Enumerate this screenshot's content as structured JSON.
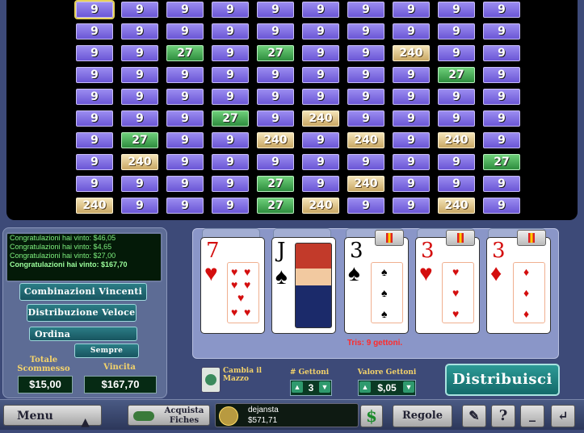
{
  "grid": [
    [
      "9",
      "9",
      "9",
      "9",
      "9",
      "9",
      "9",
      "9",
      "9",
      "9"
    ],
    [
      "9",
      "9",
      "9",
      "9",
      "9",
      "9",
      "9",
      "9",
      "9",
      "9"
    ],
    [
      "9",
      "9",
      "27",
      "9",
      "27",
      "9",
      "9",
      "240",
      "9",
      "9"
    ],
    [
      "9",
      "9",
      "9",
      "9",
      "9",
      "9",
      "9",
      "9",
      "27",
      "9"
    ],
    [
      "9",
      "9",
      "9",
      "9",
      "9",
      "9",
      "9",
      "9",
      "9",
      "9"
    ],
    [
      "9",
      "9",
      "9",
      "27",
      "9",
      "240",
      "9",
      "9",
      "9",
      "9"
    ],
    [
      "9",
      "27",
      "9",
      "9",
      "240",
      "9",
      "240",
      "9",
      "240",
      "9"
    ],
    [
      "9",
      "240",
      "9",
      "9",
      "9",
      "9",
      "9",
      "9",
      "9",
      "27"
    ],
    [
      "9",
      "9",
      "9",
      "9",
      "27",
      "9",
      "240",
      "9",
      "9",
      "9"
    ],
    [
      "240",
      "9",
      "9",
      "9",
      "27",
      "240",
      "9",
      "9",
      "240",
      "9"
    ]
  ],
  "messages": [
    "Congratulazioni hai vinto: $46,05",
    "Congratulazioni hai vinto: $4,65",
    "Congratulazioni hai vinto: $27,00",
    "Congratulazioni hai vinto: $167,70"
  ],
  "buttons": {
    "combinazioni": "Combinazioni Vincenti",
    "distribuzione": "Distribuzione Veloce",
    "ordina": "Ordina",
    "sempre": "Sempre",
    "deal": "Distribuisci",
    "menu": "Menu",
    "acquista": "Acquista Fiches",
    "regole": "Regole"
  },
  "totals": {
    "bet_label": "Totale Scommesso",
    "bet_value": "$15,00",
    "win_label": "Vincita",
    "win_value": "$167,70"
  },
  "cards": [
    {
      "rank": "7",
      "suit": "♥",
      "color": "red",
      "held": false
    },
    {
      "rank": "J",
      "suit": "♠",
      "color": "black",
      "held": false
    },
    {
      "rank": "3",
      "suit": "♠",
      "color": "black",
      "held": true
    },
    {
      "rank": "3",
      "suit": "♥",
      "color": "red",
      "held": true
    },
    {
      "rank": "3",
      "suit": "♦",
      "color": "red",
      "held": true
    }
  ],
  "result": "Tris: 9 gettoni.",
  "controls": {
    "change_deck": "Cambia il Mazzo",
    "coins_label": "# Gettoni",
    "coins_value": "3",
    "coin_value_label": "Valore Gettoni",
    "coin_value": "$,05"
  },
  "player": {
    "name": "dejansta",
    "balance": "$571,71"
  },
  "colors": {
    "badge9": "#7a66e0",
    "badge27": "#3fa150",
    "badge240": "#dcc486"
  }
}
